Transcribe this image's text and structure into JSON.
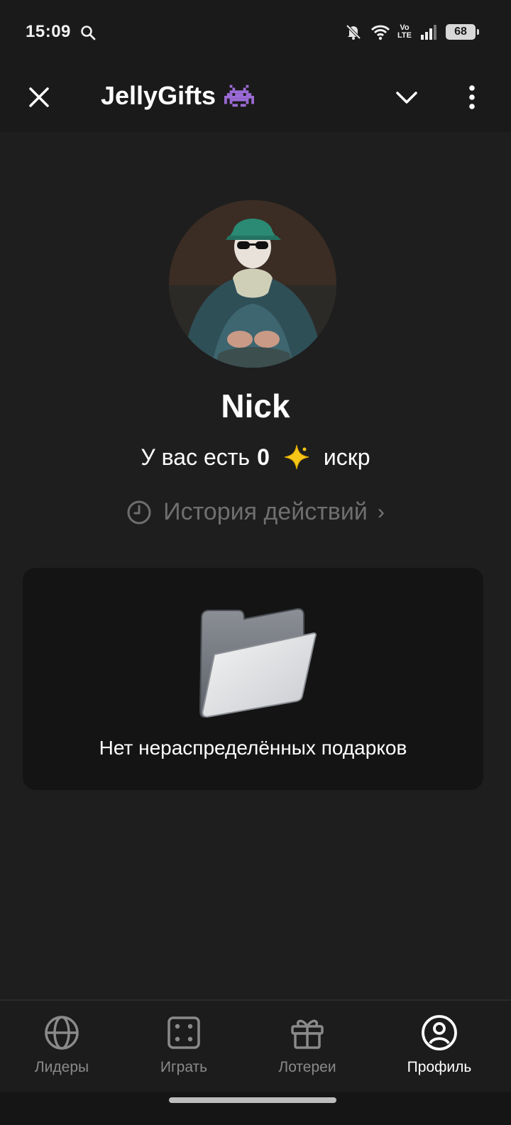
{
  "status_bar": {
    "time": "15:09",
    "volte_top": "Vo",
    "volte_bottom": "LTE",
    "battery": "68"
  },
  "header": {
    "title": "JellyGifts",
    "emoji_icon": "alien-monster-icon"
  },
  "profile": {
    "name": "Nick",
    "balance_prefix": "У вас есть",
    "balance_value": "0",
    "balance_suffix": "искр",
    "history_label": "История действий",
    "history_arrow": "›"
  },
  "gifts_card": {
    "empty_text": "Нет нераспределённых подарков"
  },
  "bottom_nav": {
    "items": [
      {
        "label": "Лидеры",
        "icon": "globe-icon",
        "active": false
      },
      {
        "label": "Играть",
        "icon": "dice-icon",
        "active": false
      },
      {
        "label": "Лотереи",
        "icon": "gift-icon",
        "active": false
      },
      {
        "label": "Профиль",
        "icon": "user-circle-icon",
        "active": true
      }
    ]
  },
  "colors": {
    "background": "#1e1e1e",
    "card": "#141414",
    "muted_text": "#6f6f6f",
    "spark": "#f5c518"
  }
}
